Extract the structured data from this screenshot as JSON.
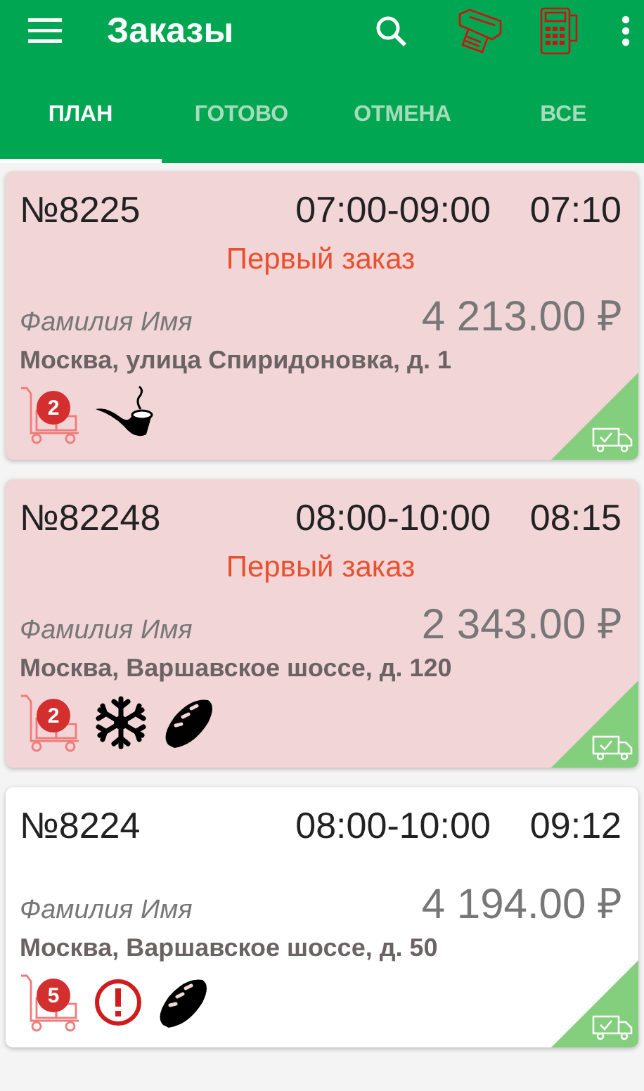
{
  "app_bar": {
    "title": "Заказы"
  },
  "tabs": [
    {
      "label": "ПЛАН",
      "selected": true
    },
    {
      "label": "ГОТОВО",
      "selected": false
    },
    {
      "label": "ОТМЕНА",
      "selected": false
    },
    {
      "label": "ВСЕ",
      "selected": false
    }
  ],
  "orders": [
    {
      "number": "№8225",
      "window": "07:00-09:00",
      "time": "07:10",
      "highlighted": true,
      "note": "Первый заказ",
      "customer": "Фамилия Имя",
      "total": "4 213.00 ₽",
      "address": "Москва, улица Спиридоновка, д. 1",
      "cart_count": "2",
      "tags": [
        {
          "kind": "pipe"
        }
      ]
    },
    {
      "number": "№82248",
      "window": "08:00-10:00",
      "time": "08:15",
      "highlighted": true,
      "note": "Первый заказ",
      "customer": "Фамилия Имя",
      "total": "2 343.00 ₽",
      "address": "Москва, Варшавское шоссе, д. 120",
      "cart_count": "2",
      "tags": [
        {
          "kind": "snowflake"
        },
        {
          "kind": "bread"
        }
      ]
    },
    {
      "number": "№8224",
      "window": "08:00-10:00",
      "time": "09:12",
      "highlighted": false,
      "customer": "Фамилия Имя",
      "total": "4 194.00 ₽",
      "address": "Москва, Варшавское шоссе, д. 50",
      "cart_count": "5",
      "tags": [
        {
          "kind": "alert"
        },
        {
          "kind": "bread"
        }
      ]
    }
  ]
}
